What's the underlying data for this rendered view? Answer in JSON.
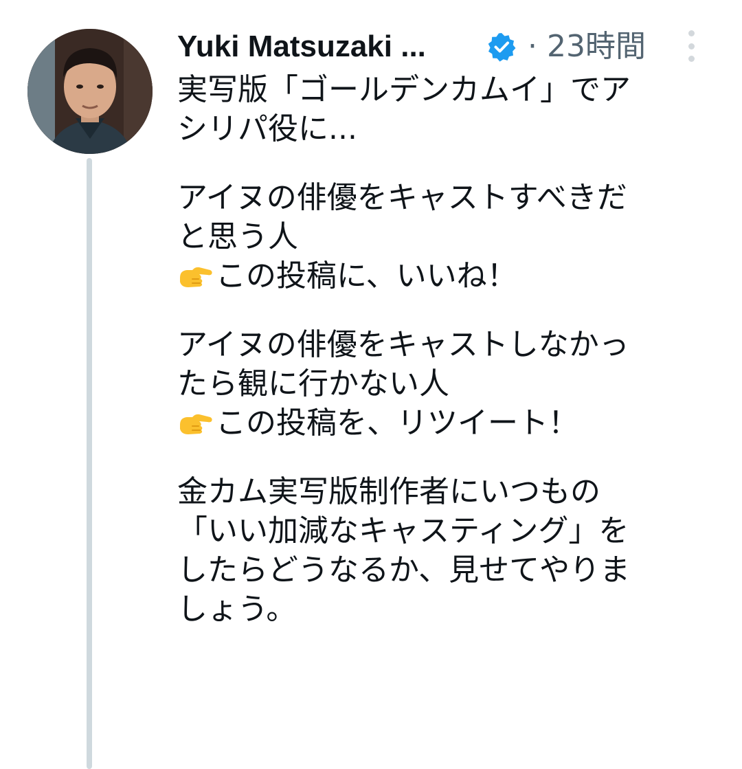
{
  "author": {
    "display_name": "Yuki Matsuzaki ...",
    "timestamp": "· 23時間",
    "verified": true,
    "verified_color": "#1d9bf0"
  },
  "icons": {
    "more": "more-vertical-icon",
    "verified": "verified-badge-icon",
    "pointing": "backhand-index-pointing-right-icon"
  },
  "tweet": {
    "para1": [
      "実写版「ゴールデンカムイ」でア",
      "シリパ役に..."
    ],
    "para2": [
      "アイヌの俳優をキャストすべきだ",
      "と思う人",
      "この投稿に、いいね！"
    ],
    "para3": [
      "アイヌの俳優をキャストしなかっ",
      "たら観に行かない人",
      "この投稿を、リツイート！"
    ],
    "para4": [
      "金カム実写版制作者にいつもの",
      "「いい加減なキャスティング」を",
      "したらどうなるか、見せてやりま",
      "しょう。"
    ]
  },
  "colors": {
    "text": "#0f1419",
    "secondary": "#536471",
    "thread_line": "#cfd9de",
    "emoji_yellow": "#fbc02d"
  }
}
